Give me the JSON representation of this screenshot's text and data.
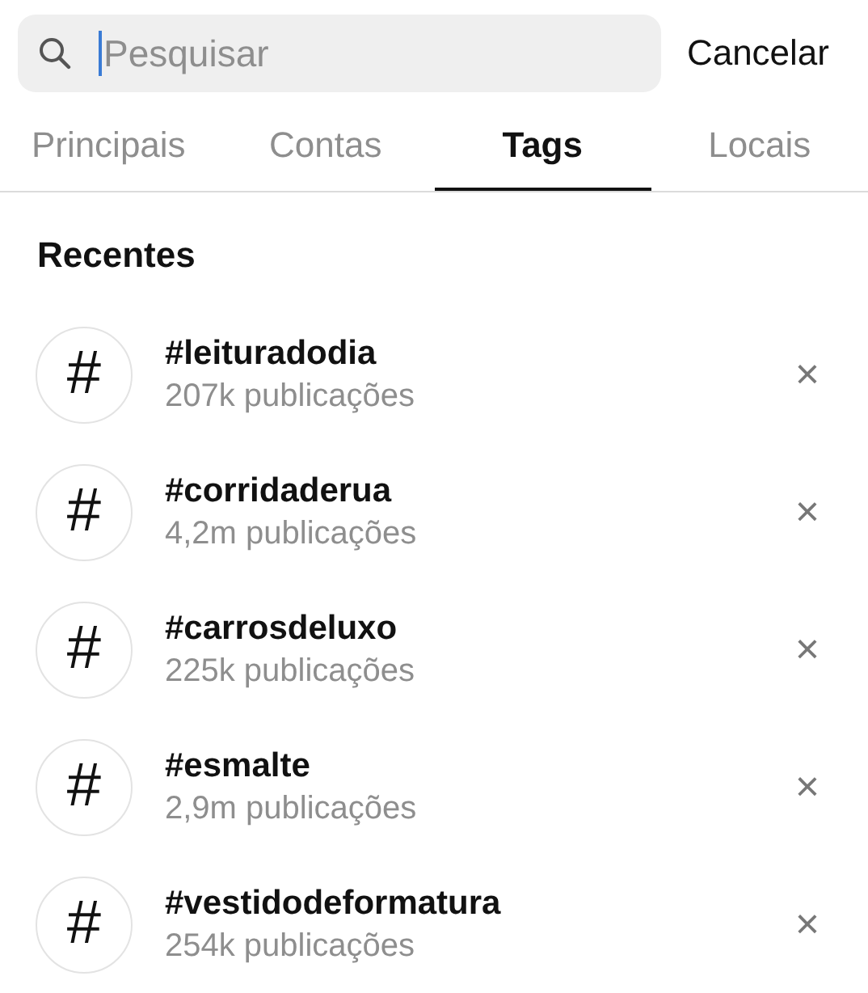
{
  "search": {
    "placeholder": "Pesquisar",
    "cancel": "Cancelar"
  },
  "tabs": [
    {
      "label": "Principais",
      "selected": false
    },
    {
      "label": "Contas",
      "selected": false
    },
    {
      "label": "Tags",
      "selected": true
    },
    {
      "label": "Locais",
      "selected": false
    }
  ],
  "section_title": "Recentes",
  "recents": [
    {
      "symbol": "#",
      "tag": "#leituradodia",
      "count": "207k publicações",
      "remove": "×"
    },
    {
      "symbol": "#",
      "tag": "#corridaderua",
      "count": "4,2m publicações",
      "remove": "×"
    },
    {
      "symbol": "#",
      "tag": "#carrosdeluxo",
      "count": "225k publicações",
      "remove": "×"
    },
    {
      "symbol": "#",
      "tag": "#esmalte",
      "count": "2,9m publicações",
      "remove": "×"
    },
    {
      "symbol": "#",
      "tag": "#vestidodeformatura",
      "count": "254k publicações",
      "remove": "×"
    }
  ]
}
